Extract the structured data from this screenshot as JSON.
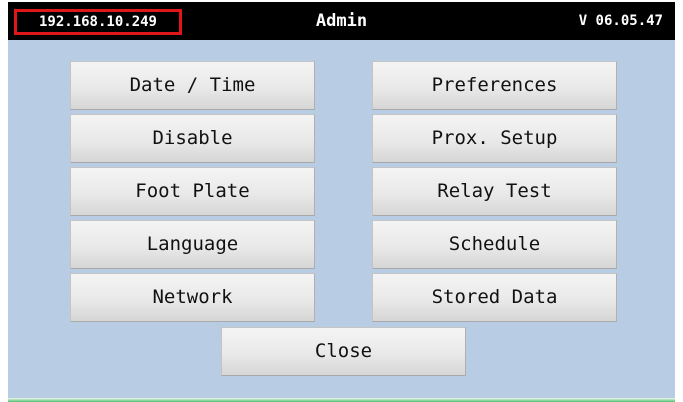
{
  "header": {
    "ip_address": "192.168.10.249",
    "title": "Admin",
    "version": "V 06.05.47"
  },
  "menu": {
    "left": [
      "Date / Time",
      "Disable",
      "Foot Plate",
      "Language",
      "Network"
    ],
    "right": [
      "Preferences",
      "Prox. Setup",
      "Relay Test",
      "Schedule",
      "Stored Data"
    ]
  },
  "close_label": "Close",
  "colors": {
    "background": "#b8cde4",
    "titlebar": "#000000",
    "ip_highlight_border": "#e0161b",
    "bottom_strip": "#4cc06a"
  }
}
